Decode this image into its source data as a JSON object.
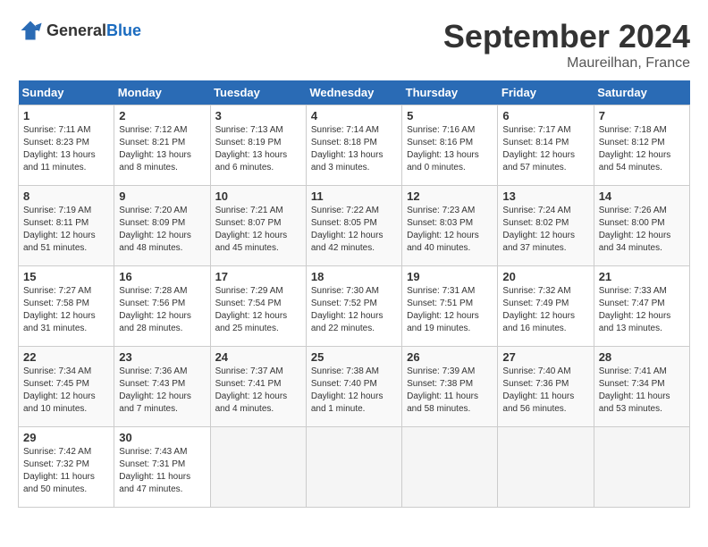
{
  "header": {
    "logo_general": "General",
    "logo_blue": "Blue",
    "month_year": "September 2024",
    "location": "Maureilhan, France"
  },
  "calendar": {
    "days_of_week": [
      "Sunday",
      "Monday",
      "Tuesday",
      "Wednesday",
      "Thursday",
      "Friday",
      "Saturday"
    ],
    "weeks": [
      [
        {
          "day": "1",
          "info": "Sunrise: 7:11 AM\nSunset: 8:23 PM\nDaylight: 13 hours\nand 11 minutes."
        },
        {
          "day": "2",
          "info": "Sunrise: 7:12 AM\nSunset: 8:21 PM\nDaylight: 13 hours\nand 8 minutes."
        },
        {
          "day": "3",
          "info": "Sunrise: 7:13 AM\nSunset: 8:19 PM\nDaylight: 13 hours\nand 6 minutes."
        },
        {
          "day": "4",
          "info": "Sunrise: 7:14 AM\nSunset: 8:18 PM\nDaylight: 13 hours\nand 3 minutes."
        },
        {
          "day": "5",
          "info": "Sunrise: 7:16 AM\nSunset: 8:16 PM\nDaylight: 13 hours\nand 0 minutes."
        },
        {
          "day": "6",
          "info": "Sunrise: 7:17 AM\nSunset: 8:14 PM\nDaylight: 12 hours\nand 57 minutes."
        },
        {
          "day": "7",
          "info": "Sunrise: 7:18 AM\nSunset: 8:12 PM\nDaylight: 12 hours\nand 54 minutes."
        }
      ],
      [
        {
          "day": "8",
          "info": "Sunrise: 7:19 AM\nSunset: 8:11 PM\nDaylight: 12 hours\nand 51 minutes."
        },
        {
          "day": "9",
          "info": "Sunrise: 7:20 AM\nSunset: 8:09 PM\nDaylight: 12 hours\nand 48 minutes."
        },
        {
          "day": "10",
          "info": "Sunrise: 7:21 AM\nSunset: 8:07 PM\nDaylight: 12 hours\nand 45 minutes."
        },
        {
          "day": "11",
          "info": "Sunrise: 7:22 AM\nSunset: 8:05 PM\nDaylight: 12 hours\nand 42 minutes."
        },
        {
          "day": "12",
          "info": "Sunrise: 7:23 AM\nSunset: 8:03 PM\nDaylight: 12 hours\nand 40 minutes."
        },
        {
          "day": "13",
          "info": "Sunrise: 7:24 AM\nSunset: 8:02 PM\nDaylight: 12 hours\nand 37 minutes."
        },
        {
          "day": "14",
          "info": "Sunrise: 7:26 AM\nSunset: 8:00 PM\nDaylight: 12 hours\nand 34 minutes."
        }
      ],
      [
        {
          "day": "15",
          "info": "Sunrise: 7:27 AM\nSunset: 7:58 PM\nDaylight: 12 hours\nand 31 minutes."
        },
        {
          "day": "16",
          "info": "Sunrise: 7:28 AM\nSunset: 7:56 PM\nDaylight: 12 hours\nand 28 minutes."
        },
        {
          "day": "17",
          "info": "Sunrise: 7:29 AM\nSunset: 7:54 PM\nDaylight: 12 hours\nand 25 minutes."
        },
        {
          "day": "18",
          "info": "Sunrise: 7:30 AM\nSunset: 7:52 PM\nDaylight: 12 hours\nand 22 minutes."
        },
        {
          "day": "19",
          "info": "Sunrise: 7:31 AM\nSunset: 7:51 PM\nDaylight: 12 hours\nand 19 minutes."
        },
        {
          "day": "20",
          "info": "Sunrise: 7:32 AM\nSunset: 7:49 PM\nDaylight: 12 hours\nand 16 minutes."
        },
        {
          "day": "21",
          "info": "Sunrise: 7:33 AM\nSunset: 7:47 PM\nDaylight: 12 hours\nand 13 minutes."
        }
      ],
      [
        {
          "day": "22",
          "info": "Sunrise: 7:34 AM\nSunset: 7:45 PM\nDaylight: 12 hours\nand 10 minutes."
        },
        {
          "day": "23",
          "info": "Sunrise: 7:36 AM\nSunset: 7:43 PM\nDaylight: 12 hours\nand 7 minutes."
        },
        {
          "day": "24",
          "info": "Sunrise: 7:37 AM\nSunset: 7:41 PM\nDaylight: 12 hours\nand 4 minutes."
        },
        {
          "day": "25",
          "info": "Sunrise: 7:38 AM\nSunset: 7:40 PM\nDaylight: 12 hours\nand 1 minute."
        },
        {
          "day": "26",
          "info": "Sunrise: 7:39 AM\nSunset: 7:38 PM\nDaylight: 11 hours\nand 58 minutes."
        },
        {
          "day": "27",
          "info": "Sunrise: 7:40 AM\nSunset: 7:36 PM\nDaylight: 11 hours\nand 56 minutes."
        },
        {
          "day": "28",
          "info": "Sunrise: 7:41 AM\nSunset: 7:34 PM\nDaylight: 11 hours\nand 53 minutes."
        }
      ],
      [
        {
          "day": "29",
          "info": "Sunrise: 7:42 AM\nSunset: 7:32 PM\nDaylight: 11 hours\nand 50 minutes."
        },
        {
          "day": "30",
          "info": "Sunrise: 7:43 AM\nSunset: 7:31 PM\nDaylight: 11 hours\nand 47 minutes."
        },
        {
          "day": "",
          "info": ""
        },
        {
          "day": "",
          "info": ""
        },
        {
          "day": "",
          "info": ""
        },
        {
          "day": "",
          "info": ""
        },
        {
          "day": "",
          "info": ""
        }
      ]
    ]
  }
}
